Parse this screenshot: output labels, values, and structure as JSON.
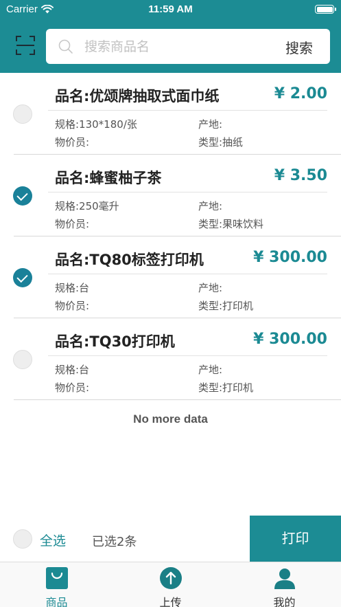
{
  "status_bar": {
    "carrier": "Carrier",
    "time": "11:59 AM"
  },
  "search": {
    "placeholder": "搜索商品名",
    "button_label": "搜索"
  },
  "products": [
    {
      "name": "品名:优颂牌抽取式面巾纸",
      "price": "¥ 2.00",
      "spec": "规格:130*180/张",
      "origin": "产地:",
      "pricer": "物价员:",
      "type": "类型:抽纸",
      "checked": false
    },
    {
      "name": "品名:蜂蜜柚子茶",
      "price": "¥ 3.50",
      "spec": "规格:250毫升",
      "origin": "产地:",
      "pricer": "物价员:",
      "type": "类型:果味饮料",
      "checked": true
    },
    {
      "name": "品名:TQ80标签打印机",
      "price": "¥ 300.00",
      "spec": "规格:台",
      "origin": "产地:",
      "pricer": "物价员:",
      "type": "类型:打印机",
      "checked": true
    },
    {
      "name": "品名:TQ30打印机",
      "price": "¥ 300.00",
      "spec": "规格:台",
      "origin": "产地:",
      "pricer": "物价员:",
      "type": "类型:打印机",
      "checked": false
    }
  ],
  "list_footer": "No more data",
  "bottom_bar": {
    "select_all_label": "全选",
    "selected_count": "已选2条",
    "print_label": "打印"
  },
  "tabs": [
    {
      "label": "商品",
      "icon": "bag-icon",
      "active": true
    },
    {
      "label": "上传",
      "icon": "upload-icon",
      "active": false
    },
    {
      "label": "我的",
      "icon": "person-icon",
      "active": false
    }
  ],
  "colors": {
    "primary": "#1c8c94",
    "check_active": "#1a8199",
    "price": "#1b8a93"
  }
}
